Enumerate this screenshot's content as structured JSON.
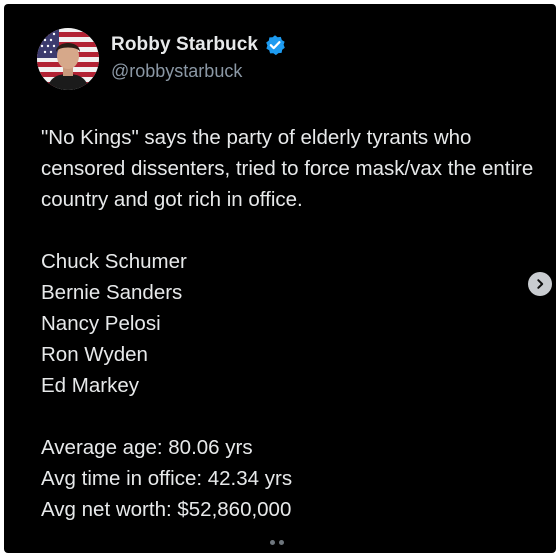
{
  "author": {
    "display_name": "Robby Starbuck",
    "handle": "@robbystarbuck",
    "verified": true,
    "verified_color": "#1d9bf0",
    "avatar_icon": "profile-photo-with-flag-background"
  },
  "tweet": {
    "intro": "\"No Kings\" says the party of elderly tyrants who censored dissenters, tried to force mask/vax the entire country and got rich in office.",
    "names": [
      "Chuck Schumer",
      "Bernie Sanders",
      "Nancy Pelosi",
      "Ron Wyden",
      "Ed Markey"
    ],
    "stats": [
      "Average age: 80.06 yrs",
      "Avg time in office: 42.34 yrs",
      "Avg net worth: $52,860,000"
    ]
  },
  "controls": {
    "next_icon": "chevron-right-icon",
    "page_indicator_count": 2
  },
  "colors": {
    "background": "#000000",
    "text": "#e7e9ea",
    "secondary_text": "#8b98a5"
  }
}
